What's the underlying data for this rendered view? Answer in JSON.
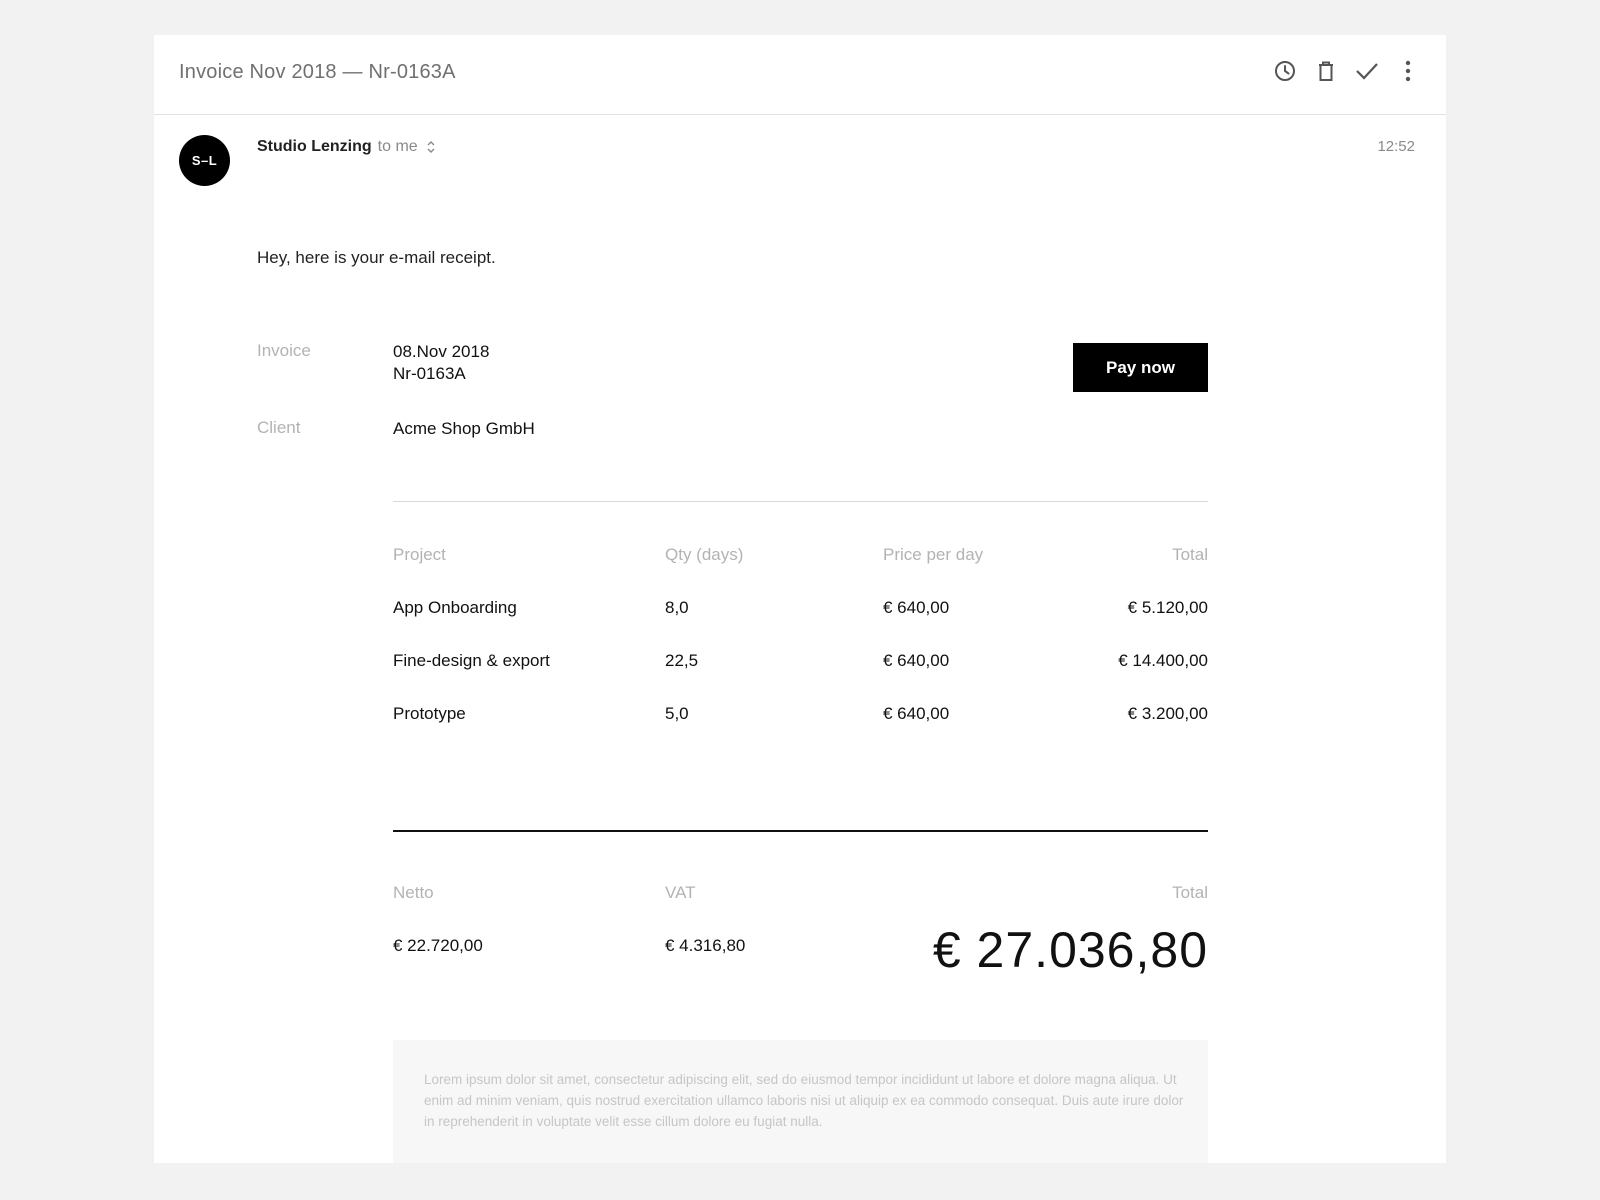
{
  "email": {
    "subject": "Invoice Nov 2018 — Nr-0163A",
    "actions": [
      {
        "name": "snooze",
        "icon": "clock-icon"
      },
      {
        "name": "delete",
        "icon": "trash-icon"
      },
      {
        "name": "done",
        "icon": "check-icon"
      },
      {
        "name": "more",
        "icon": "more-vertical-icon"
      }
    ],
    "sender": {
      "avatar_initials": "S–L",
      "name": "Studio Lenzing",
      "recipient": "to me",
      "time": "12:52"
    },
    "greeting": "Hey, here is your e-mail receipt."
  },
  "invoice": {
    "label": "Invoice",
    "date": "08.Nov 2018",
    "number": "Nr-0163A",
    "client_label": "Client",
    "client": "Acme Shop GmbH",
    "pay_button": "Pay now"
  },
  "table": {
    "headers": [
      "Project",
      "Qty (days)",
      "Price per day",
      "Total"
    ],
    "rows": [
      {
        "project": "App Onboarding",
        "qty": "8,0",
        "price": "€ 640,00",
        "total": "€ 5.120,00"
      },
      {
        "project": "Fine-design & export",
        "qty": "22,5",
        "price": "€ 640,00",
        "total": "€ 14.400,00"
      },
      {
        "project": "Prototype",
        "qty": "5,0",
        "price": "€ 640,00",
        "total": "€ 3.200,00"
      }
    ]
  },
  "summary": {
    "netto_label": "Netto",
    "netto": "€ 22.720,00",
    "vat_label": "VAT",
    "vat": "€ 4.316,80",
    "total_label": "Total",
    "total": "€ 27.036,80"
  },
  "footer": {
    "text": "Lorem ipsum dolor sit amet, consectetur adipiscing elit, sed do eiusmod tempor incididunt ut labore et dolore magna aliqua. Ut enim ad minim veniam, quis nostrud exercitation ullamco laboris nisi ut aliquip ex ea commodo consequat. Duis aute irure dolor in reprehenderit in voluptate velit esse cillum dolore eu fugiat nulla."
  },
  "colors": {
    "background": "#f2f2f2",
    "card": "#ffffff",
    "accent": "#000000",
    "muted_text": "#b3b3b3"
  }
}
